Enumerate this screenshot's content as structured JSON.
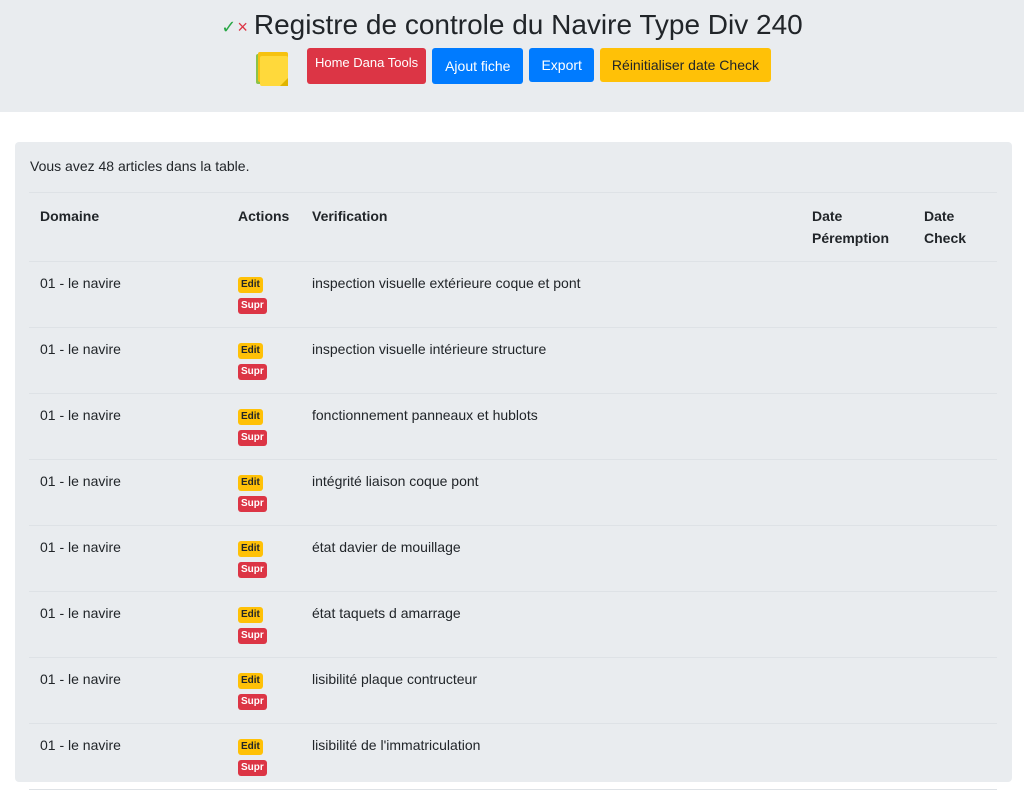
{
  "header": {
    "check_glyph": "✓",
    "cross_glyph": "×",
    "title": "Registre de controle du Navire Type Div 240",
    "notes_icon": "sticky-notes-icon",
    "buttons": {
      "home": "Home Dana Tools",
      "add": "Ajout fiche",
      "export": "Export",
      "reset": "Réinitialiser date Check"
    }
  },
  "main": {
    "count_text": "Vous avez 48 articles dans la table.",
    "columns": {
      "domain": "Domaine",
      "actions": "Actions",
      "verification": "Verification",
      "date_peremption_1": "Date",
      "date_peremption_2": "Péremption",
      "date_check_1": "Date",
      "date_check_2": "Check"
    },
    "edit_label": "Edit",
    "delete_label": "Supr",
    "rows": [
      {
        "domain": "01 - le navire",
        "verification": "inspection visuelle extérieure coque et pont",
        "date_peremption": "",
        "date_check": ""
      },
      {
        "domain": "01 - le navire",
        "verification": "inspection visuelle intérieure structure",
        "date_peremption": "",
        "date_check": ""
      },
      {
        "domain": "01 - le navire",
        "verification": "fonctionnement panneaux et hublots",
        "date_peremption": "",
        "date_check": ""
      },
      {
        "domain": "01 - le navire",
        "verification": "intégrité liaison coque pont",
        "date_peremption": "",
        "date_check": ""
      },
      {
        "domain": "01 - le navire",
        "verification": "état davier de mouillage",
        "date_peremption": "",
        "date_check": ""
      },
      {
        "domain": "01 - le navire",
        "verification": "état taquets d amarrage",
        "date_peremption": "",
        "date_check": ""
      },
      {
        "domain": "01 - le navire",
        "verification": "lisibilité plaque contructeur",
        "date_peremption": "",
        "date_check": ""
      },
      {
        "domain": "01 - le navire",
        "verification": "lisibilité de l'immatriculation",
        "date_peremption": "",
        "date_check": ""
      }
    ]
  },
  "colors": {
    "header_bg": "#e9ecef",
    "danger": "#dc3545",
    "primary": "#007bff",
    "warning": "#ffc107",
    "success": "#28a745"
  }
}
